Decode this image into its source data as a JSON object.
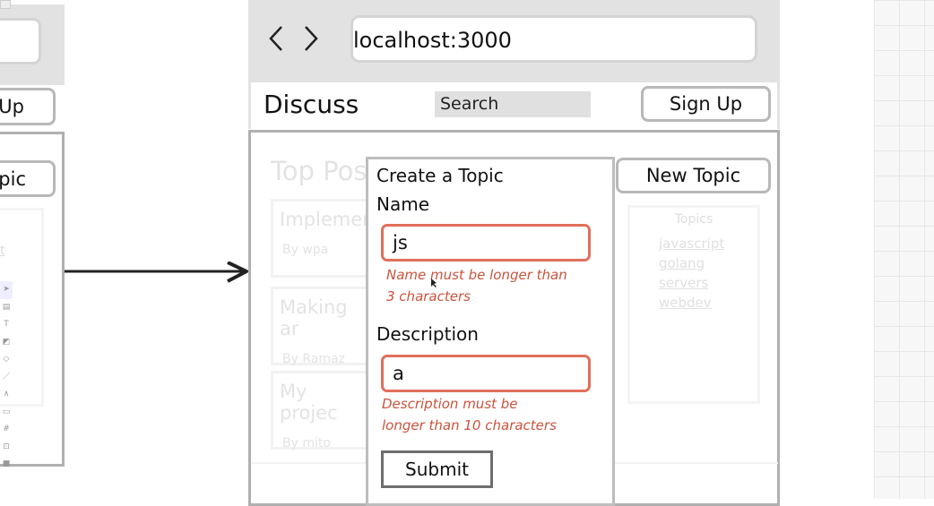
{
  "left_frame": {
    "signup_partial": "Up",
    "new_topic_partial": "pic",
    "link_partial": "t"
  },
  "browser": {
    "url": "localhost:3000",
    "back_icon": "chevron-left-icon",
    "forward_icon": "chevron-right-icon"
  },
  "navbar": {
    "brand": "Discuss",
    "search_placeholder": "Search",
    "signup_label": "Sign Up"
  },
  "page": {
    "heading": "Top Pos",
    "posts": [
      {
        "title": "Implemen",
        "author": "By wpa"
      },
      {
        "title": "Making ar",
        "author": "By Ramaz"
      },
      {
        "title": "My projec",
        "author": "By mito"
      }
    ],
    "new_topic_label": "New Topic",
    "topics_title": "Topics",
    "topics": [
      "javascript",
      "golang",
      "servers",
      "webdev"
    ]
  },
  "modal": {
    "title": "Create a Topic",
    "name_label": "Name",
    "name_value": "js",
    "name_error_1": "Name must be longer than",
    "name_error_2": "3 characters",
    "desc_label": "Description",
    "desc_value": "a",
    "desc_error_1": "Description must be",
    "desc_error_2": "longer than 10 characters",
    "submit_label": "Submit"
  },
  "colors": {
    "error": "#c9533d",
    "error_border": "#e0705a",
    "chrome": "#e2e2e2"
  }
}
